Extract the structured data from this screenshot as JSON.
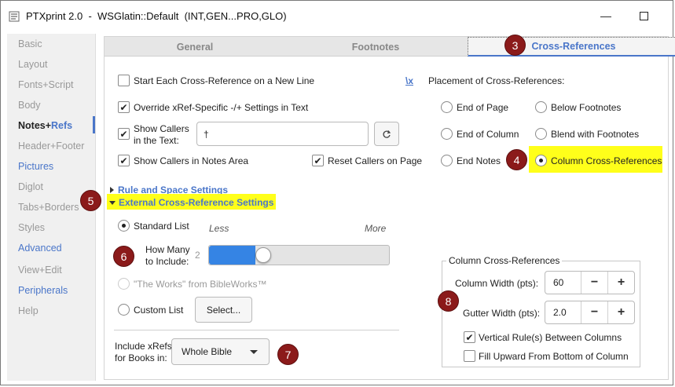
{
  "window": {
    "title": "PTXprint 2.0  -  WSGlatin::Default  (INT,GEN...PRO,GLO)",
    "minimize_glyph": "—",
    "maximize_glyph": "☐"
  },
  "sidebar": {
    "items": [
      {
        "label": "Basic"
      },
      {
        "label": "Layout"
      },
      {
        "label": "Fonts+Script"
      },
      {
        "label": "Body"
      },
      {
        "label": "Notes+",
        "suffix": "Refs"
      },
      {
        "label": "Header+Footer"
      },
      {
        "label": "Pictures"
      },
      {
        "label": "Diglot"
      },
      {
        "label": "Tabs+Borders"
      },
      {
        "label": "Styles"
      },
      {
        "label": "Advanced"
      },
      {
        "label": "View+Edit"
      },
      {
        "label": "Peripherals"
      },
      {
        "label": "Help"
      }
    ]
  },
  "tabs": {
    "general": "General",
    "footnotes": "Footnotes",
    "cross_references": "Cross-References"
  },
  "badges": {
    "b3": "3",
    "b4": "4",
    "b5": "5",
    "b6": "6",
    "b7": "7",
    "b8": "8"
  },
  "left": {
    "start_each": "Start Each Cross-Reference on a New Line",
    "override": "Override xRef-Specific -/+ Settings in Text",
    "show_callers_1": "Show Callers",
    "show_callers_2": "in the Text:",
    "caller_value": "†",
    "show_callers_notes": "Show Callers in Notes Area",
    "reset_callers": "Reset Callers on Page",
    "rule_space": "Rule and Space Settings",
    "external": "External Cross-Reference Settings",
    "standard_list": "Standard List",
    "less": "Less",
    "more": "More",
    "how_many_1": "How Many",
    "how_many_2": "to Include:",
    "how_many_value": "2",
    "how_many_fraction": 0.25,
    "the_works": "\"The Works\" from BibleWorks™",
    "custom_list": "Custom List",
    "select_button": "Select...",
    "include_1": "Include xRefs",
    "include_2": "for Books in:",
    "books_selected": "Whole Bible"
  },
  "right": {
    "marker": "\\x",
    "placement_label": "Placement of Cross-References:",
    "end_of_page": "End of Page",
    "below_footnotes": "Below Footnotes",
    "end_of_column": "End of Column",
    "blend_footnotes": "Blend with Footnotes",
    "end_notes": "End Notes",
    "column_xrefs": "Column Cross-References"
  },
  "column_frame": {
    "title": "Column Cross-References",
    "column_width_label": "Column Width (pts):",
    "column_width_value": "60",
    "gutter_width_label": "Gutter Width (pts):",
    "gutter_width_value": "2.0",
    "minus": "−",
    "plus": "+",
    "vertical_rules": "Vertical Rule(s) Between Columns",
    "fill_upward": "Fill Upward From Bottom of Column"
  },
  "colors": {
    "accent": "#4a76c9",
    "badge": "#8b1a1a",
    "highlight": "#ffff1a",
    "slider": "#3584e4"
  }
}
